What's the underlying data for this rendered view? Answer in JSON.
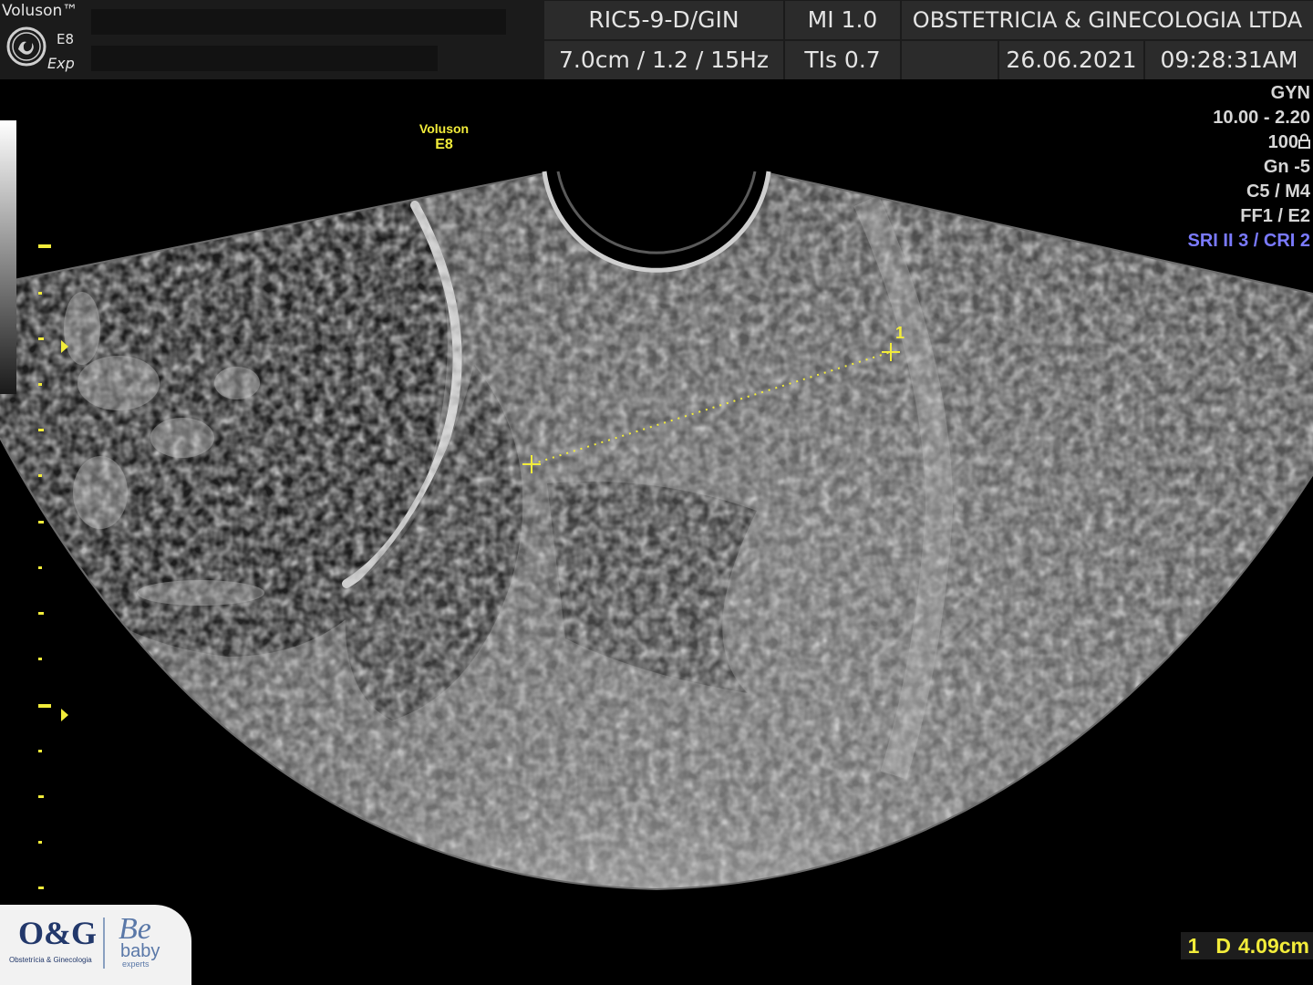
{
  "header": {
    "brand": "Voluson™",
    "model": "E8",
    "mode": "Exp",
    "probe": "RIC5-9-D/GIN",
    "depth_info": "7.0cm / 1.2 / 15Hz",
    "mi": "MI  1.0",
    "tis": "TIs  0.7",
    "institution": "OBSTETRICIA & GINECOLOGIA LTDA",
    "date": "26.06.2021",
    "time": "09:28:31AM"
  },
  "params": {
    "preset": "GYN",
    "frequency": "10.00 - 2.20",
    "power": "100",
    "gain": "Gn  -5",
    "map": "C5 / M4",
    "filter": "FF1 / E2",
    "sri": "SRI II 3 / CRI 2"
  },
  "probe_label": {
    "line1": "Voluson",
    "line2": "E8"
  },
  "caliper": {
    "marker_number": "1"
  },
  "measurement": {
    "index": "1",
    "type": "D",
    "value": "4.09cm"
  },
  "watermark": {
    "og": "O&G",
    "og_subtitle": "Obstetrícia & Ginecologia",
    "be": "Be",
    "baby": "baby",
    "experts": "experts"
  },
  "colors": {
    "overlay_yellow": "#f2ec3a",
    "sri_blue": "#7a7aff",
    "header_bg": "#2b2b2b"
  }
}
